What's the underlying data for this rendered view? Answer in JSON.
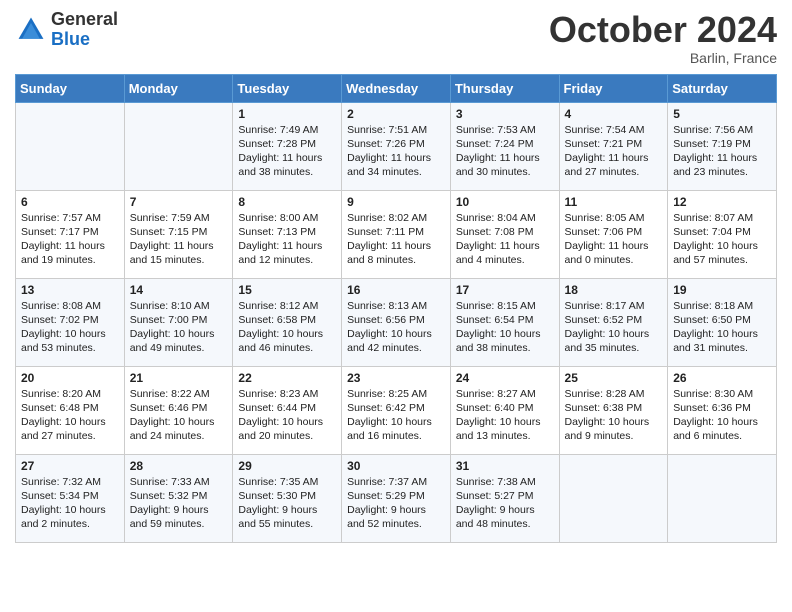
{
  "header": {
    "logo_general": "General",
    "logo_blue": "Blue",
    "month_title": "October 2024",
    "location": "Barlin, France"
  },
  "days_of_week": [
    "Sunday",
    "Monday",
    "Tuesday",
    "Wednesday",
    "Thursday",
    "Friday",
    "Saturday"
  ],
  "weeks": [
    [
      {
        "day": "",
        "content": ""
      },
      {
        "day": "",
        "content": ""
      },
      {
        "day": "1",
        "content": "Sunrise: 7:49 AM\nSunset: 7:28 PM\nDaylight: 11 hours and 38 minutes."
      },
      {
        "day": "2",
        "content": "Sunrise: 7:51 AM\nSunset: 7:26 PM\nDaylight: 11 hours and 34 minutes."
      },
      {
        "day": "3",
        "content": "Sunrise: 7:53 AM\nSunset: 7:24 PM\nDaylight: 11 hours and 30 minutes."
      },
      {
        "day": "4",
        "content": "Sunrise: 7:54 AM\nSunset: 7:21 PM\nDaylight: 11 hours and 27 minutes."
      },
      {
        "day": "5",
        "content": "Sunrise: 7:56 AM\nSunset: 7:19 PM\nDaylight: 11 hours and 23 minutes."
      }
    ],
    [
      {
        "day": "6",
        "content": "Sunrise: 7:57 AM\nSunset: 7:17 PM\nDaylight: 11 hours and 19 minutes."
      },
      {
        "day": "7",
        "content": "Sunrise: 7:59 AM\nSunset: 7:15 PM\nDaylight: 11 hours and 15 minutes."
      },
      {
        "day": "8",
        "content": "Sunrise: 8:00 AM\nSunset: 7:13 PM\nDaylight: 11 hours and 12 minutes."
      },
      {
        "day": "9",
        "content": "Sunrise: 8:02 AM\nSunset: 7:11 PM\nDaylight: 11 hours and 8 minutes."
      },
      {
        "day": "10",
        "content": "Sunrise: 8:04 AM\nSunset: 7:08 PM\nDaylight: 11 hours and 4 minutes."
      },
      {
        "day": "11",
        "content": "Sunrise: 8:05 AM\nSunset: 7:06 PM\nDaylight: 11 hours and 0 minutes."
      },
      {
        "day": "12",
        "content": "Sunrise: 8:07 AM\nSunset: 7:04 PM\nDaylight: 10 hours and 57 minutes."
      }
    ],
    [
      {
        "day": "13",
        "content": "Sunrise: 8:08 AM\nSunset: 7:02 PM\nDaylight: 10 hours and 53 minutes."
      },
      {
        "day": "14",
        "content": "Sunrise: 8:10 AM\nSunset: 7:00 PM\nDaylight: 10 hours and 49 minutes."
      },
      {
        "day": "15",
        "content": "Sunrise: 8:12 AM\nSunset: 6:58 PM\nDaylight: 10 hours and 46 minutes."
      },
      {
        "day": "16",
        "content": "Sunrise: 8:13 AM\nSunset: 6:56 PM\nDaylight: 10 hours and 42 minutes."
      },
      {
        "day": "17",
        "content": "Sunrise: 8:15 AM\nSunset: 6:54 PM\nDaylight: 10 hours and 38 minutes."
      },
      {
        "day": "18",
        "content": "Sunrise: 8:17 AM\nSunset: 6:52 PM\nDaylight: 10 hours and 35 minutes."
      },
      {
        "day": "19",
        "content": "Sunrise: 8:18 AM\nSunset: 6:50 PM\nDaylight: 10 hours and 31 minutes."
      }
    ],
    [
      {
        "day": "20",
        "content": "Sunrise: 8:20 AM\nSunset: 6:48 PM\nDaylight: 10 hours and 27 minutes."
      },
      {
        "day": "21",
        "content": "Sunrise: 8:22 AM\nSunset: 6:46 PM\nDaylight: 10 hours and 24 minutes."
      },
      {
        "day": "22",
        "content": "Sunrise: 8:23 AM\nSunset: 6:44 PM\nDaylight: 10 hours and 20 minutes."
      },
      {
        "day": "23",
        "content": "Sunrise: 8:25 AM\nSunset: 6:42 PM\nDaylight: 10 hours and 16 minutes."
      },
      {
        "day": "24",
        "content": "Sunrise: 8:27 AM\nSunset: 6:40 PM\nDaylight: 10 hours and 13 minutes."
      },
      {
        "day": "25",
        "content": "Sunrise: 8:28 AM\nSunset: 6:38 PM\nDaylight: 10 hours and 9 minutes."
      },
      {
        "day": "26",
        "content": "Sunrise: 8:30 AM\nSunset: 6:36 PM\nDaylight: 10 hours and 6 minutes."
      }
    ],
    [
      {
        "day": "27",
        "content": "Sunrise: 7:32 AM\nSunset: 5:34 PM\nDaylight: 10 hours and 2 minutes."
      },
      {
        "day": "28",
        "content": "Sunrise: 7:33 AM\nSunset: 5:32 PM\nDaylight: 9 hours and 59 minutes."
      },
      {
        "day": "29",
        "content": "Sunrise: 7:35 AM\nSunset: 5:30 PM\nDaylight: 9 hours and 55 minutes."
      },
      {
        "day": "30",
        "content": "Sunrise: 7:37 AM\nSunset: 5:29 PM\nDaylight: 9 hours and 52 minutes."
      },
      {
        "day": "31",
        "content": "Sunrise: 7:38 AM\nSunset: 5:27 PM\nDaylight: 9 hours and 48 minutes."
      },
      {
        "day": "",
        "content": ""
      },
      {
        "day": "",
        "content": ""
      }
    ]
  ]
}
